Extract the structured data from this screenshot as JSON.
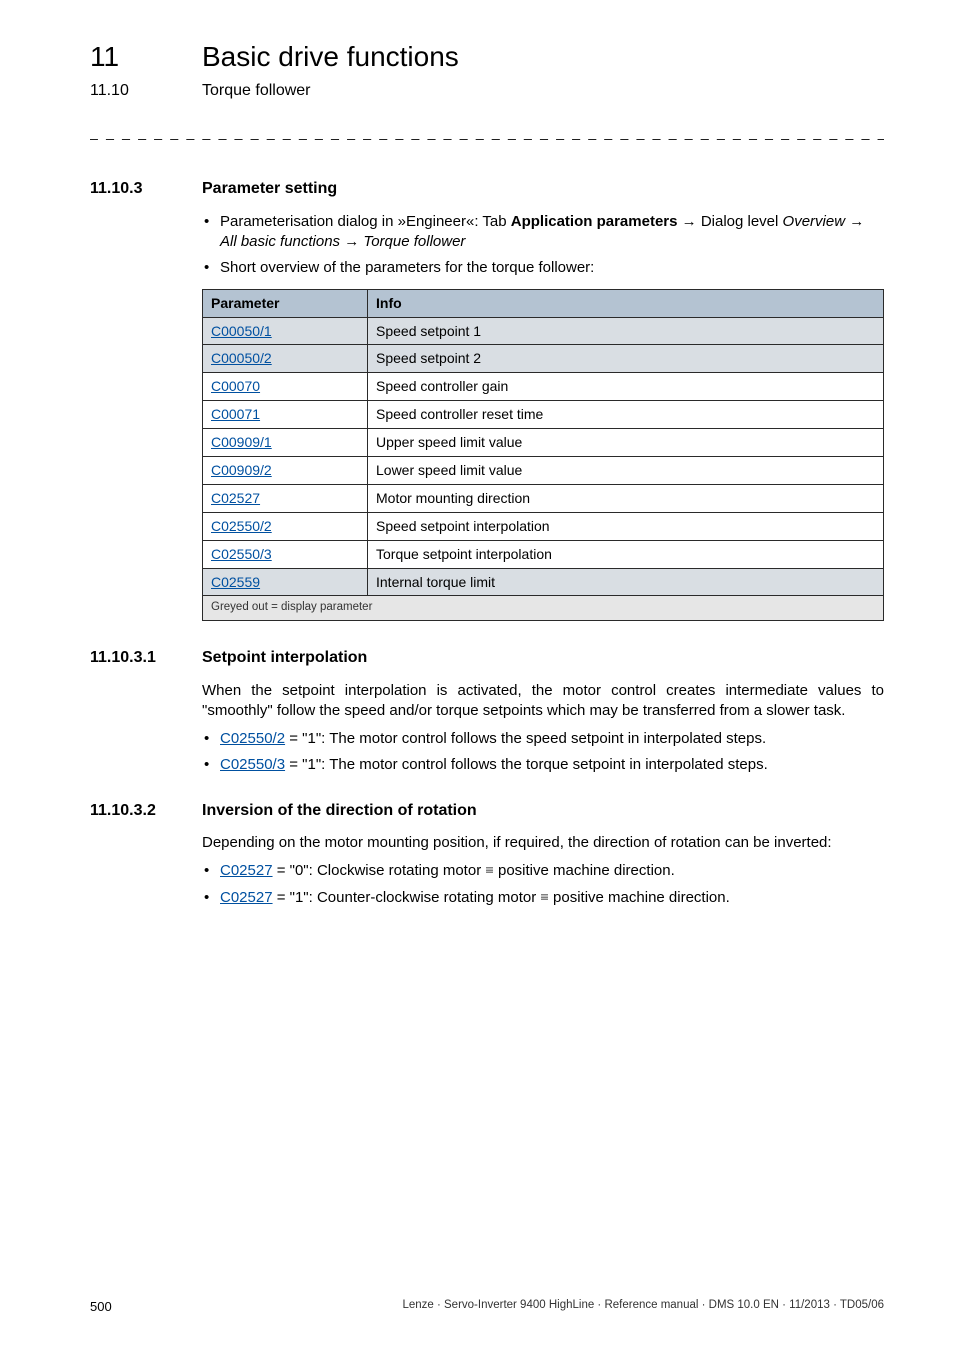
{
  "chapter": {
    "num": "11",
    "title": "Basic drive functions"
  },
  "subchapter": {
    "num": "11.10",
    "title": "Torque follower"
  },
  "dashes": "_ _ _ _ _ _ _ _ _ _ _ _ _ _ _ _ _ _ _ _ _ _ _ _ _ _ _ _ _ _ _ _ _ _ _ _ _ _ _ _ _ _ _ _ _ _ _ _ _ _ _ _ _ _ _ _ _ _ _ _ _ _ _ _",
  "s11103": {
    "num": "11.10.3",
    "title": "Parameter setting",
    "bullets": {
      "b1_pre": "Parameterisation dialog in »Engineer«: Tab ",
      "b1_bold": "Application parameters",
      "b1_arrow": " → ",
      "b1_i1": "Overview",
      "b1_mid": " Dialog level ",
      "b1_i2": "All basic functions",
      "b1_i3": "Torque follower",
      "b2": "Short overview of the parameters for the torque follower:"
    },
    "table": {
      "h1": "Parameter",
      "h2": "Info",
      "rows": [
        {
          "code": "C00050/1",
          "info": "Speed setpoint 1",
          "grey": true
        },
        {
          "code": "C00050/2",
          "info": "Speed setpoint 2",
          "grey": true
        },
        {
          "code": "C00070",
          "info": "Speed controller gain",
          "grey": false
        },
        {
          "code": "C00071",
          "info": "Speed controller reset time",
          "grey": false
        },
        {
          "code": "C00909/1",
          "info": "Upper speed limit value",
          "grey": false
        },
        {
          "code": "C00909/2",
          "info": "Lower speed limit value",
          "grey": false
        },
        {
          "code": "C02527",
          "info": "Motor mounting direction",
          "grey": false
        },
        {
          "code": "C02550/2",
          "info": "Speed setpoint interpolation",
          "grey": false
        },
        {
          "code": "C02550/3",
          "info": "Torque setpoint interpolation",
          "grey": false
        },
        {
          "code": "C02559",
          "info": "Internal torque limit",
          "grey": true
        }
      ],
      "footnote": "Greyed out = display parameter"
    }
  },
  "s111031": {
    "num": "11.10.3.1",
    "title": "Setpoint interpolation",
    "para": "When the setpoint interpolation is activated, the motor control creates intermediate values to \"smoothly\" follow the speed and/or torque setpoints which may be transferred from a slower task.",
    "bullets": [
      {
        "code": "C02550/2",
        "tail": " = \"1\": The motor control follows the speed setpoint in interpolated steps."
      },
      {
        "code": "C02550/3",
        "tail": " = \"1\": The motor control follows the torque setpoint in interpolated steps."
      }
    ]
  },
  "s111032": {
    "num": "11.10.3.2",
    "title": "Inversion of the direction of rotation",
    "para": "Depending on the motor mounting position, if required, the direction of rotation can be inverted:",
    "bullets": [
      {
        "code": "C02527",
        "mid": " = \"0\": Clockwise rotating motor ",
        "tail": " positive machine direction."
      },
      {
        "code": "C02527",
        "mid": " = \"1\": Counter-clockwise rotating motor ",
        "tail": " positive machine direction."
      }
    ]
  },
  "footer": {
    "page": "500",
    "right": "Lenze · Servo-Inverter 9400 HighLine · Reference manual · DMS 10.0 EN · 11/2013 · TD05/06"
  }
}
